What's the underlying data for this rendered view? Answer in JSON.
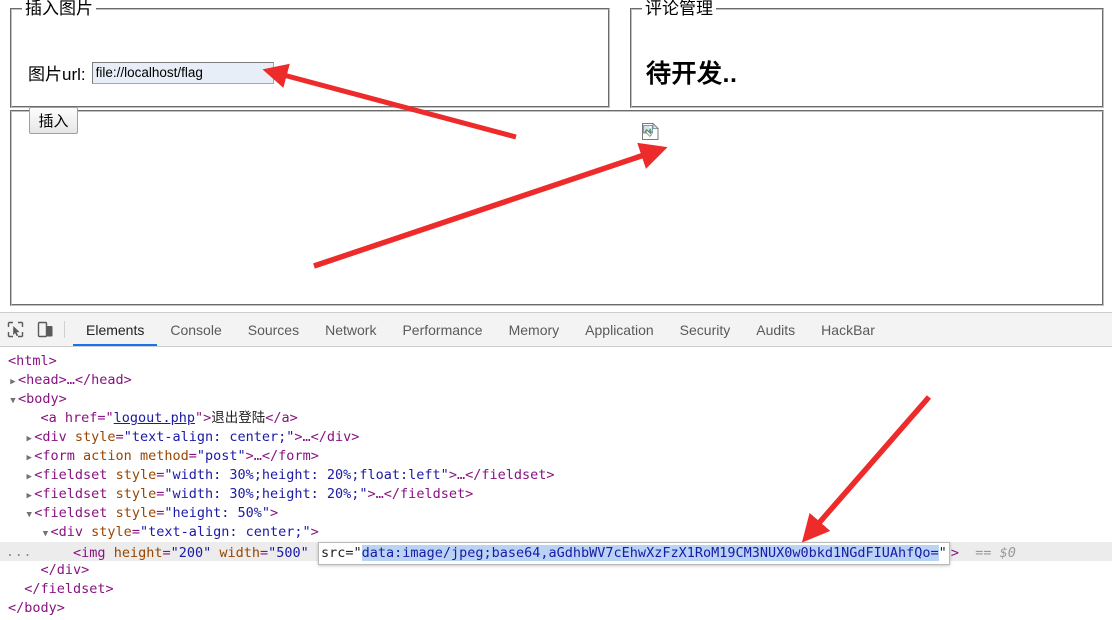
{
  "page": {
    "insert_image_fieldset": {
      "legend": "插入图片",
      "url_label": "图片url:",
      "url_value": "file://localhost/flag",
      "url_placeholder": "",
      "insert_button": "插入"
    },
    "comment_fieldset": {
      "legend": "评论管理",
      "heading": "待开发.."
    },
    "image_fieldset": {
      "broken_image_alt": "broken-image-placeholder"
    }
  },
  "devtools": {
    "icons": {
      "inspect": "inspect-element-icon",
      "device": "device-toolbar-icon"
    },
    "tabs": [
      {
        "label": "Elements",
        "active": true
      },
      {
        "label": "Console",
        "active": false
      },
      {
        "label": "Sources",
        "active": false
      },
      {
        "label": "Network",
        "active": false
      },
      {
        "label": "Performance",
        "active": false
      },
      {
        "label": "Memory",
        "active": false
      },
      {
        "label": "Application",
        "active": false
      },
      {
        "label": "Security",
        "active": false
      },
      {
        "label": "Audits",
        "active": false
      },
      {
        "label": "HackBar",
        "active": false
      }
    ],
    "dom": {
      "l1": "<html>",
      "l2_tag": "<head>…</head>",
      "l3_tag": "<body>",
      "l4_pre": "<a href=\"",
      "l4_link": "logout.php",
      "l4_mid": "\">",
      "l4_text": "退出登陆",
      "l4_end": "</a>",
      "l5_tag": "<div",
      "l5_attr": "style",
      "l5_val": "\"text-align: center;\"",
      "l5_end": ">…</div>",
      "l6_tag": "<form",
      "l6_attr1": "action",
      "l6_attr2": "method",
      "l6_val2": "\"post\"",
      "l6_end": ">…</form>",
      "l7_tag": "<fieldset",
      "l7_attr": "style",
      "l7_val": "\"width: 30%;height: 20%;float:left\"",
      "l7_end": ">…</fieldset>",
      "l8_tag": "<fieldset",
      "l8_attr": "style",
      "l8_val": "\"width: 30%;height: 20%;\"",
      "l8_end": ">…</fieldset>",
      "l9_tag": "<fieldset",
      "l9_attr": "style",
      "l9_val": "\"height: 50%\"",
      "l9_end": ">",
      "l10_tag": "<div",
      "l10_attr": "style",
      "l10_val": "\"text-align: center;\"",
      "l10_end": ">",
      "l11_dots": "...",
      "l11_tag": "<img",
      "l11_attr_height": "height",
      "l11_val_height": "\"200\"",
      "l11_attr_width": "width",
      "l11_val_width": "\"500\"",
      "l11_attr_src": "src=\"",
      "l11_val_src": "data:image/jpeg;base64,aGdhbWV7cEhwXzFzX1RoM19CM3NUX0w0bkd1NGdFIUAhfQo=",
      "l11_quote": "\"",
      "l11_gt": ">",
      "l11_dollar": "== $0",
      "l12": "</div>",
      "l13": "</fieldset>",
      "l14": "</body>"
    }
  },
  "annotations": {
    "arrow_color": "#ee2b2b",
    "arrows": [
      {
        "name": "arrow-to-url-input",
        "from": [
          516,
          137
        ],
        "to": [
          268,
          71
        ]
      },
      {
        "name": "arrow-to-broken-image",
        "from": [
          314,
          266
        ],
        "to": [
          661,
          150
        ]
      },
      {
        "name": "arrow-to-base64-src",
        "from": [
          929,
          397
        ],
        "to": [
          806,
          537
        ]
      }
    ]
  },
  "colors": {
    "accent": "#1a73e8",
    "tag": "#881280",
    "attr_name": "#994500",
    "attr_value": "#1a1aa6",
    "selection": "#b9d3f5",
    "autofill_input": "#e8eef8",
    "selected_row": "#ececec"
  }
}
